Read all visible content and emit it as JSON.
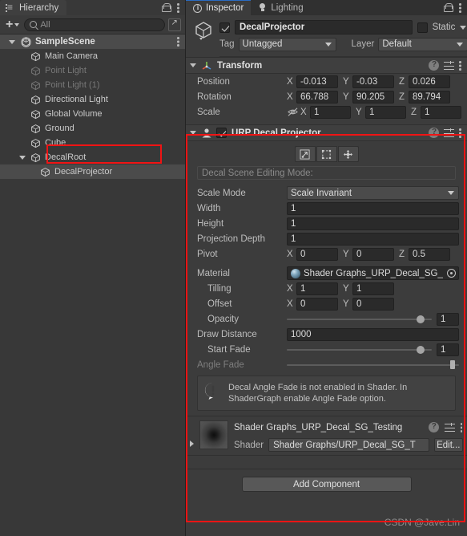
{
  "hierarchy": {
    "tab_label": "Hierarchy",
    "tab_icon": "hierarchy-list-icon",
    "toolbar": {
      "add_label": "+",
      "search_placeholder": "All",
      "search_value": ""
    },
    "scene": {
      "name": "SampleScene",
      "expanded": true
    },
    "items": [
      {
        "label": "Main Camera",
        "depth": 1,
        "dim": false,
        "selected": false,
        "expandable": false
      },
      {
        "label": "Point Light",
        "depth": 1,
        "dim": true,
        "selected": false,
        "expandable": false
      },
      {
        "label": "Point Light (1)",
        "depth": 1,
        "dim": true,
        "selected": false,
        "expandable": false
      },
      {
        "label": "Directional Light",
        "depth": 1,
        "dim": false,
        "selected": false,
        "expandable": false
      },
      {
        "label": "Global Volume",
        "depth": 1,
        "dim": false,
        "selected": false,
        "expandable": false
      },
      {
        "label": "Ground",
        "depth": 1,
        "dim": false,
        "selected": false,
        "expandable": false
      },
      {
        "label": "Cube",
        "depth": 1,
        "dim": false,
        "selected": false,
        "expandable": false
      },
      {
        "label": "DecalRoot",
        "depth": 1,
        "dim": false,
        "selected": false,
        "expandable": true
      },
      {
        "label": "DecalProjector",
        "depth": 2,
        "dim": false,
        "selected": true,
        "expandable": false
      }
    ]
  },
  "inspector": {
    "tabs": [
      {
        "label": "Inspector",
        "icon": "info-circle-icon",
        "active": true
      },
      {
        "label": "Lighting",
        "icon": "light-bulb-icon",
        "active": false
      }
    ],
    "object": {
      "icon": "game-object-cube-icon",
      "enabled": true,
      "name": "DecalProjector",
      "static_label": "Static",
      "static_checked": false,
      "tag_label": "Tag",
      "tag_value": "Untagged",
      "layer_label": "Layer",
      "layer_value": "Default"
    },
    "transform": {
      "title": "Transform",
      "icon": "transform-axis-icon",
      "expanded": true,
      "rows": [
        {
          "label": "Position",
          "x": "-0.013",
          "y": "-0.03",
          "z": "0.026"
        },
        {
          "label": "Rotation",
          "x": "66.788",
          "y": "90.205",
          "z": "89.794"
        },
        {
          "label": "Scale",
          "x": "1",
          "y": "1",
          "z": "1",
          "constrain_icon": "scale-link-off-icon"
        }
      ],
      "axis_labels": [
        "X",
        "Y",
        "Z"
      ]
    },
    "decal": {
      "title": "URP Decal Projector",
      "icon": "script-component-icon",
      "enabled": true,
      "expanded": true,
      "tools": [
        {
          "name": "scale-handle-tool",
          "glyph": "resize"
        },
        {
          "name": "uv-rect-tool",
          "glyph": "dashedbox"
        },
        {
          "name": "pivot-move-tool",
          "glyph": "move"
        }
      ],
      "edit_mode_label": "Decal Scene Editing Mode:",
      "scale_mode_label": "Scale Mode",
      "scale_mode_value": "Scale Invariant",
      "width_label": "Width",
      "width_value": "1",
      "height_label": "Height",
      "height_value": "1",
      "projection_depth_label": "Projection Depth",
      "projection_depth_value": "1",
      "pivot_label": "Pivot",
      "pivot_x": "0",
      "pivot_y": "0",
      "pivot_z": "0.5",
      "material_label": "Material",
      "material_value": "Shader Graphs_URP_Decal_SG_",
      "tilling_label": "Tilling",
      "tilling_x": "1",
      "tilling_y": "1",
      "offset_label": "Offset",
      "offset_x": "0",
      "offset_y": "0",
      "opacity_label": "Opacity",
      "opacity_value": "1",
      "opacity_pct": 92,
      "draw_distance_label": "Draw Distance",
      "draw_distance_value": "1000",
      "start_fade_label": "Start Fade",
      "start_fade_value": "1",
      "start_fade_pct": 92,
      "angle_fade_label": "Angle Fade",
      "angle_fade_pct": 97,
      "warning_icon": "warning-exclamation-icon",
      "warning_text": "Decal Angle Fade is not enabled in Shader. In ShaderGraph enable Angle Fade option."
    },
    "material_block": {
      "preview_icon": "material-preview-thumbnail",
      "title": "Shader Graphs_URP_Decal_SG_Testing",
      "shader_label": "Shader",
      "shader_value": "Shader Graphs/URP_Decal_SG_T",
      "edit_label": "Edit...",
      "expanded": false
    },
    "add_component_label": "Add Component"
  },
  "watermark": "CSDN @Jave.Lin",
  "colors": {
    "panel_bg": "#3c3c3c",
    "hierarchy_bg": "#383838",
    "field_bg": "#2a2a2a",
    "accent_tab": "#2a6cc4",
    "annotation_red": "#f01414",
    "selected_row": "#4b4b4b"
  }
}
